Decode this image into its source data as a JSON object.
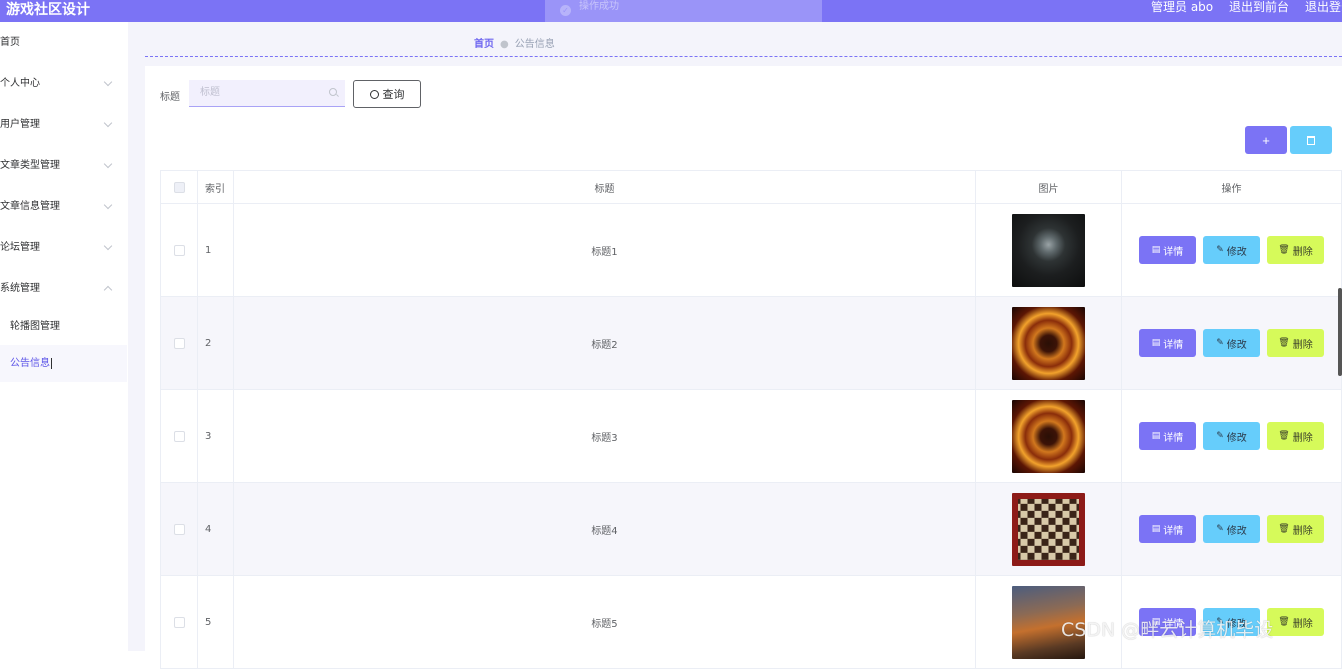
{
  "header": {
    "brand": "游戏社区设计",
    "toast": "操作成功",
    "user": "管理员 abo",
    "back_to_front": "退出到前台",
    "logout": "退出登录"
  },
  "sidebar": {
    "items": [
      {
        "label": "首页"
      },
      {
        "label": "个人中心"
      },
      {
        "label": "用户管理"
      },
      {
        "label": "文章类型管理"
      },
      {
        "label": "文章信息管理"
      },
      {
        "label": "论坛管理"
      },
      {
        "label": "系统管理"
      }
    ],
    "sub_items": [
      {
        "label": "轮播图管理"
      },
      {
        "label": "公告信息"
      }
    ]
  },
  "breadcrumb": {
    "home": "首页",
    "current": "公告信息"
  },
  "search": {
    "label": "标题",
    "placeholder": "标题",
    "button": "查询"
  },
  "actions": {
    "add": "+"
  },
  "table": {
    "columns": [
      "索引",
      "标题",
      "图片",
      "操作"
    ],
    "rows": [
      {
        "index": "1",
        "title": "标题1",
        "image": "dark-game-icon"
      },
      {
        "index": "2",
        "title": "标题2",
        "image": "mockingjay-fire"
      },
      {
        "index": "3",
        "title": "标题3",
        "image": "mockingjay-fire"
      },
      {
        "index": "4",
        "title": "标题4",
        "image": "chess-board"
      },
      {
        "index": "5",
        "title": "标题5",
        "image": "warrior-art"
      }
    ],
    "op_labels": {
      "detail": "详情",
      "edit": "修改",
      "delete": "删除"
    }
  },
  "watermark": "CSDN @畔云计算机毕设",
  "colors": {
    "primary": "#7b73f5",
    "info": "#66cdfb",
    "warning": "#d6fa5a"
  }
}
